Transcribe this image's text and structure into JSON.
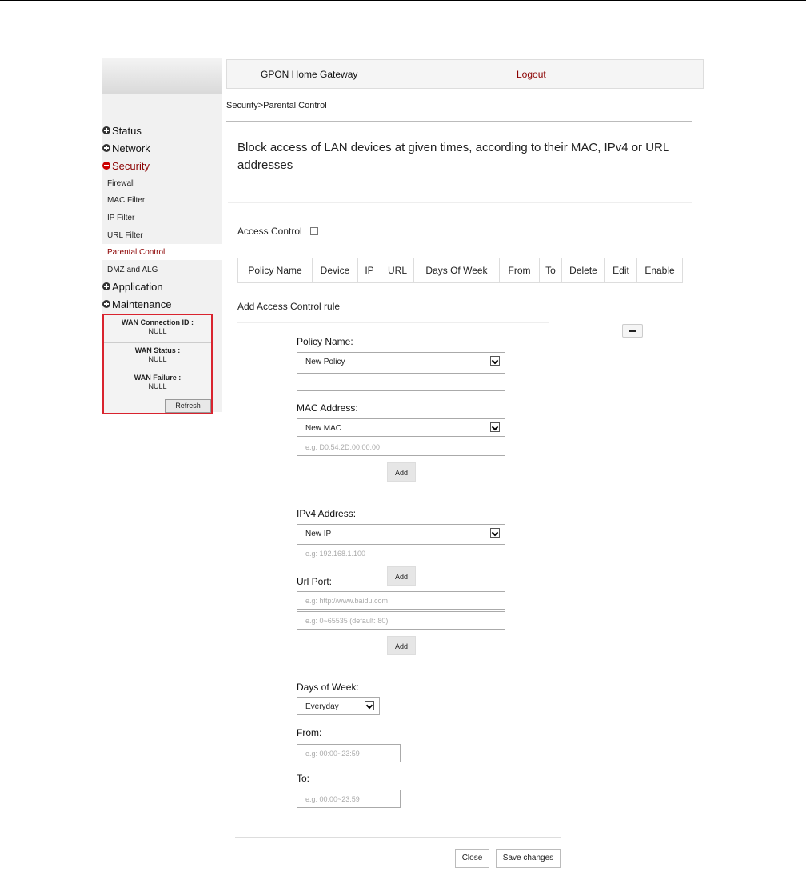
{
  "header": {
    "brand": "GPON Home Gateway",
    "logout": "Logout"
  },
  "breadcrumb": "Security>Parental Control",
  "description": "Block access of LAN devices at given times, according to their MAC, IPv4 or URL addresses",
  "sidebar": {
    "items": [
      {
        "label": "Status",
        "icon": "plus-circle-icon"
      },
      {
        "label": "Network",
        "icon": "plus-circle-icon"
      },
      {
        "label": "Security",
        "icon": "minus-circle-icon"
      }
    ],
    "subitems": [
      "Firewall",
      "MAC Filter",
      "IP Filter",
      "URL Filter",
      "Parental Control",
      "DMZ and ALG"
    ],
    "items_after": [
      {
        "label": "Application",
        "icon": "plus-circle-icon"
      },
      {
        "label": "Maintenance",
        "icon": "plus-circle-icon"
      }
    ],
    "wan": {
      "connection_id_label": "WAN Connection ID :",
      "connection_id_value": "NULL",
      "status_label": "WAN Status :",
      "status_value": "NULL",
      "failure_label": "WAN Failure :",
      "failure_value": "NULL",
      "refresh": "Refresh"
    }
  },
  "access_control": {
    "label": "Access Control",
    "checked": false
  },
  "table": {
    "columns": [
      "Policy Name",
      "Device",
      "IP",
      "URL",
      "Days Of Week",
      "From",
      "To",
      "Delete",
      "Edit",
      "Enable"
    ]
  },
  "form": {
    "title": "Add Access Control rule",
    "policy_name_label": "Policy Name:",
    "policy_select": "New Policy",
    "mac_label": "MAC Address:",
    "mac_select": "New MAC",
    "mac_placeholder": "e.g: D0:54:2D:00:00:00",
    "add": "Add",
    "ipv4_label": "IPv4 Address:",
    "ip_select": "New IP",
    "ip_placeholder": "e.g: 192.168.1.100",
    "url_port_label": "Url Port:",
    "url_placeholder": "e.g: http://www.baidu.com",
    "port_placeholder": "e.g: 0~65535 (default: 80)",
    "days_label": "Days of Week:",
    "days_select": "Everyday",
    "from_label": "From:",
    "from_placeholder": "e.g: 00:00~23:59",
    "to_label": "To:",
    "to_placeholder": "e.g: 00:00~23:59",
    "close": "Close",
    "save": "Save changes"
  },
  "colors": {
    "accent": "#8b0000",
    "wan_border": "#d9232e"
  }
}
